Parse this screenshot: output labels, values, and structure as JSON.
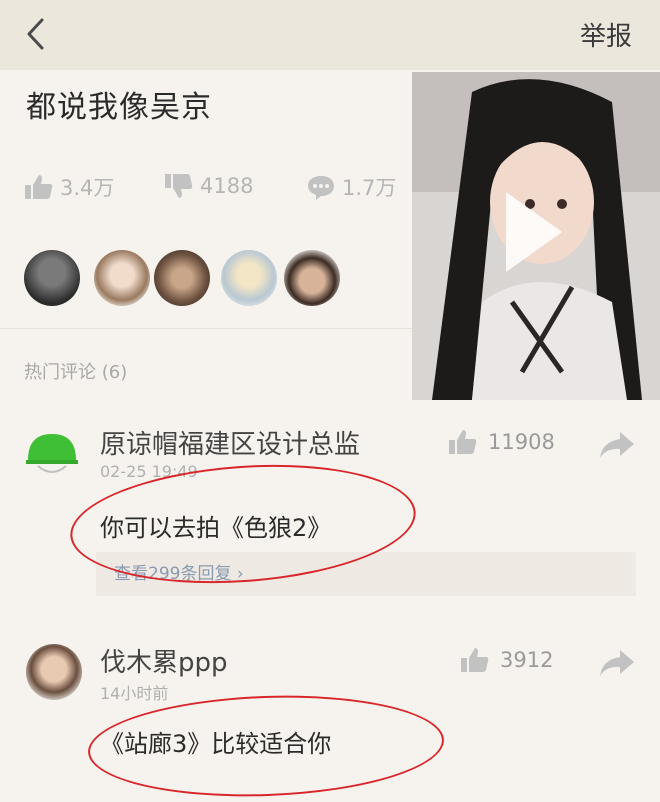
{
  "header": {
    "report_label": "举报"
  },
  "post": {
    "title": "都说我像吴京",
    "likes": "3.4万",
    "dislikes": "4188",
    "comments": "1.7万"
  },
  "comments_section": {
    "header": "热门评论 (6)",
    "items": [
      {
        "username": "原谅帽福建区设计总监",
        "time": "02-25 19:49",
        "likes": "11908",
        "text": "你可以去拍《色狼2》",
        "replies": "查看299条回复 ›"
      },
      {
        "username": "伐木累ppp",
        "time": "14小时前",
        "likes": "3912",
        "text": "《站廊3》比较适合你"
      }
    ]
  },
  "colors": {
    "annotation_circle": "#d8262b",
    "topbar": "#ece7dd",
    "background": "#f6f3ee"
  }
}
